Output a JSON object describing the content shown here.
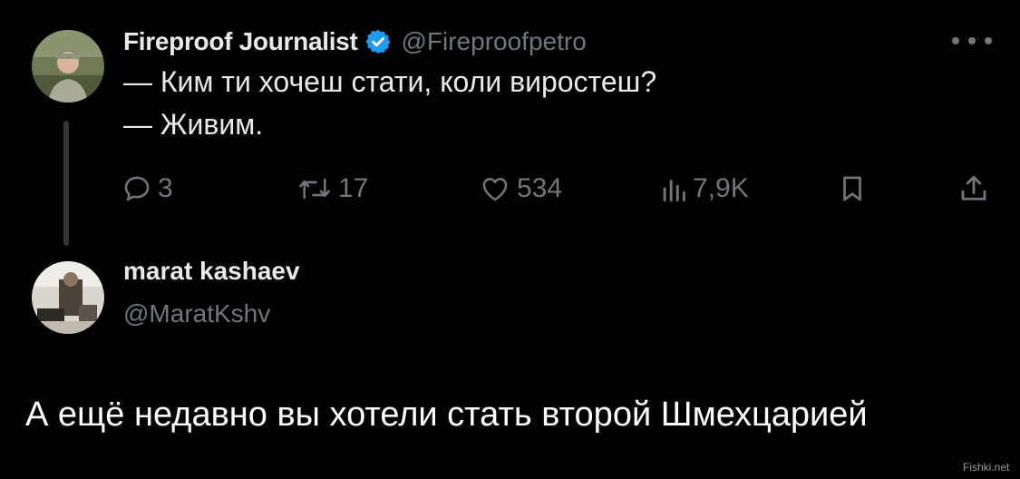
{
  "tweet": {
    "author": {
      "name": "Fireproof Journalist",
      "handle": "@Fireproofpetro",
      "verified": true
    },
    "text_lines": [
      "— Ким ти хочеш стати, коли виростеш?",
      "— Живим."
    ],
    "actions": {
      "replies": "3",
      "retweets": "17",
      "likes": "534",
      "views": "7,9K"
    }
  },
  "reply": {
    "author": {
      "name": "marat kashaev",
      "handle": "@MaratKshv"
    }
  },
  "caption": "А ещё недавно вы хотели стать второй Шмехцарией",
  "watermark": "Fishki.net",
  "colors": {
    "background": "#000000",
    "text_primary": "#e7e9ea",
    "text_secondary": "#71767b",
    "verified_badge": "#1d9bf0",
    "thread_line": "#333639"
  },
  "icons": [
    "verified-icon",
    "more-icon",
    "reply-icon",
    "retweet-icon",
    "like-icon",
    "views-icon",
    "bookmark-icon",
    "share-icon"
  ]
}
